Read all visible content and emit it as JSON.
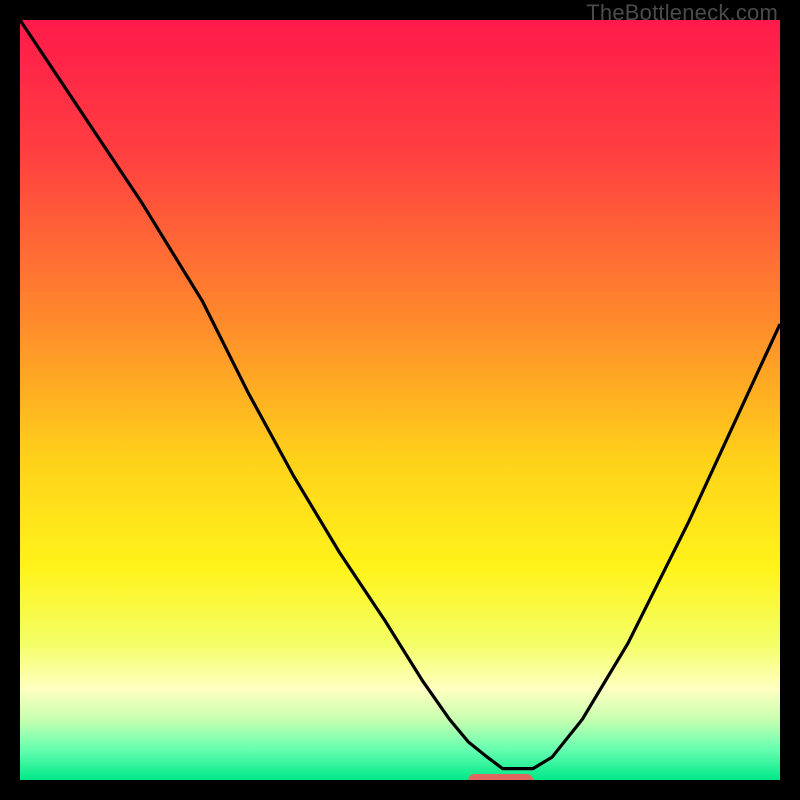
{
  "watermark": "TheBottleneck.com",
  "chart_data": {
    "type": "line",
    "title": "",
    "xlabel": "",
    "ylabel": "",
    "xlim": [
      0,
      100
    ],
    "ylim": [
      0,
      100
    ],
    "series": [
      {
        "name": "curve",
        "x": [
          0,
          8,
          16,
          24,
          30,
          36,
          42,
          48,
          53,
          56.5,
          59,
          61.5,
          63.5,
          67.5,
          70,
          74,
          80,
          88,
          100
        ],
        "values": [
          100,
          88,
          76,
          63,
          51,
          40,
          30,
          21,
          13,
          8,
          5,
          3,
          1.5,
          1.5,
          3,
          8,
          18,
          34,
          60
        ]
      }
    ],
    "marker": {
      "x_start": 59,
      "x_end": 67.5,
      "y": 0
    },
    "gradient_stops": [
      {
        "offset": 0.0,
        "color": "#ff1a4b"
      },
      {
        "offset": 0.18,
        "color": "#ff4040"
      },
      {
        "offset": 0.4,
        "color": "#ff8b2b"
      },
      {
        "offset": 0.58,
        "color": "#ffd21a"
      },
      {
        "offset": 0.72,
        "color": "#fff31a"
      },
      {
        "offset": 0.82,
        "color": "#f4ff66"
      },
      {
        "offset": 0.88,
        "color": "#ffffc0"
      },
      {
        "offset": 0.92,
        "color": "#c8ffb0"
      },
      {
        "offset": 0.96,
        "color": "#66ffb0"
      },
      {
        "offset": 1.0,
        "color": "#00e888"
      }
    ],
    "marker_color": "#e0685f",
    "curve_color": "#000000"
  }
}
